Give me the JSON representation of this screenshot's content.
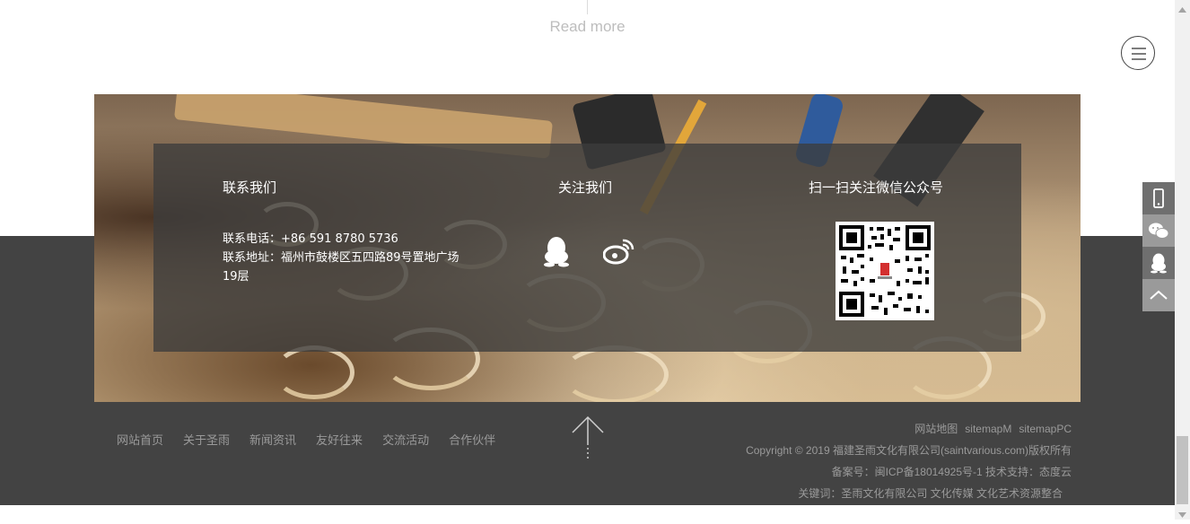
{
  "top": {
    "read_more": "Read more"
  },
  "footer_panel": {
    "contact_title": "联系我们",
    "phone_label": "联系电话：",
    "phone": "+86 591 8780 5736",
    "address_label": "联系地址：",
    "address": "福州市鼓楼区五四路89号置地广场19层",
    "follow_title": "关注我们",
    "wechat_title": "扫一扫关注微信公众号"
  },
  "nav": {
    "items": [
      "网站首页",
      "关于圣雨",
      "新闻资讯",
      "友好往来",
      "交流活动",
      "合作伙伴"
    ]
  },
  "footer_right": {
    "sitemap": "网站地图",
    "sitemap_m": "sitemapM",
    "sitemap_pc": "sitemapPC",
    "copyright": "Copyright © 2019 福建圣雨文化有限公司(saintvarious.com)版权所有",
    "icp": "备案号：闽ICP备18014925号-1   技术支持：态度云",
    "keywords": "关键词：圣雨文化有限公司 文化传媒 文化艺术资源整合"
  },
  "side_tools": [
    "mobile-icon",
    "wechat-icon",
    "qq-icon",
    "back-to-top-icon"
  ],
  "colors": {
    "dark_band": "#434343",
    "panel": "#3c3c3c",
    "side_btn": "#6f6f6f",
    "side_btn_top": "#9a9a9a"
  }
}
